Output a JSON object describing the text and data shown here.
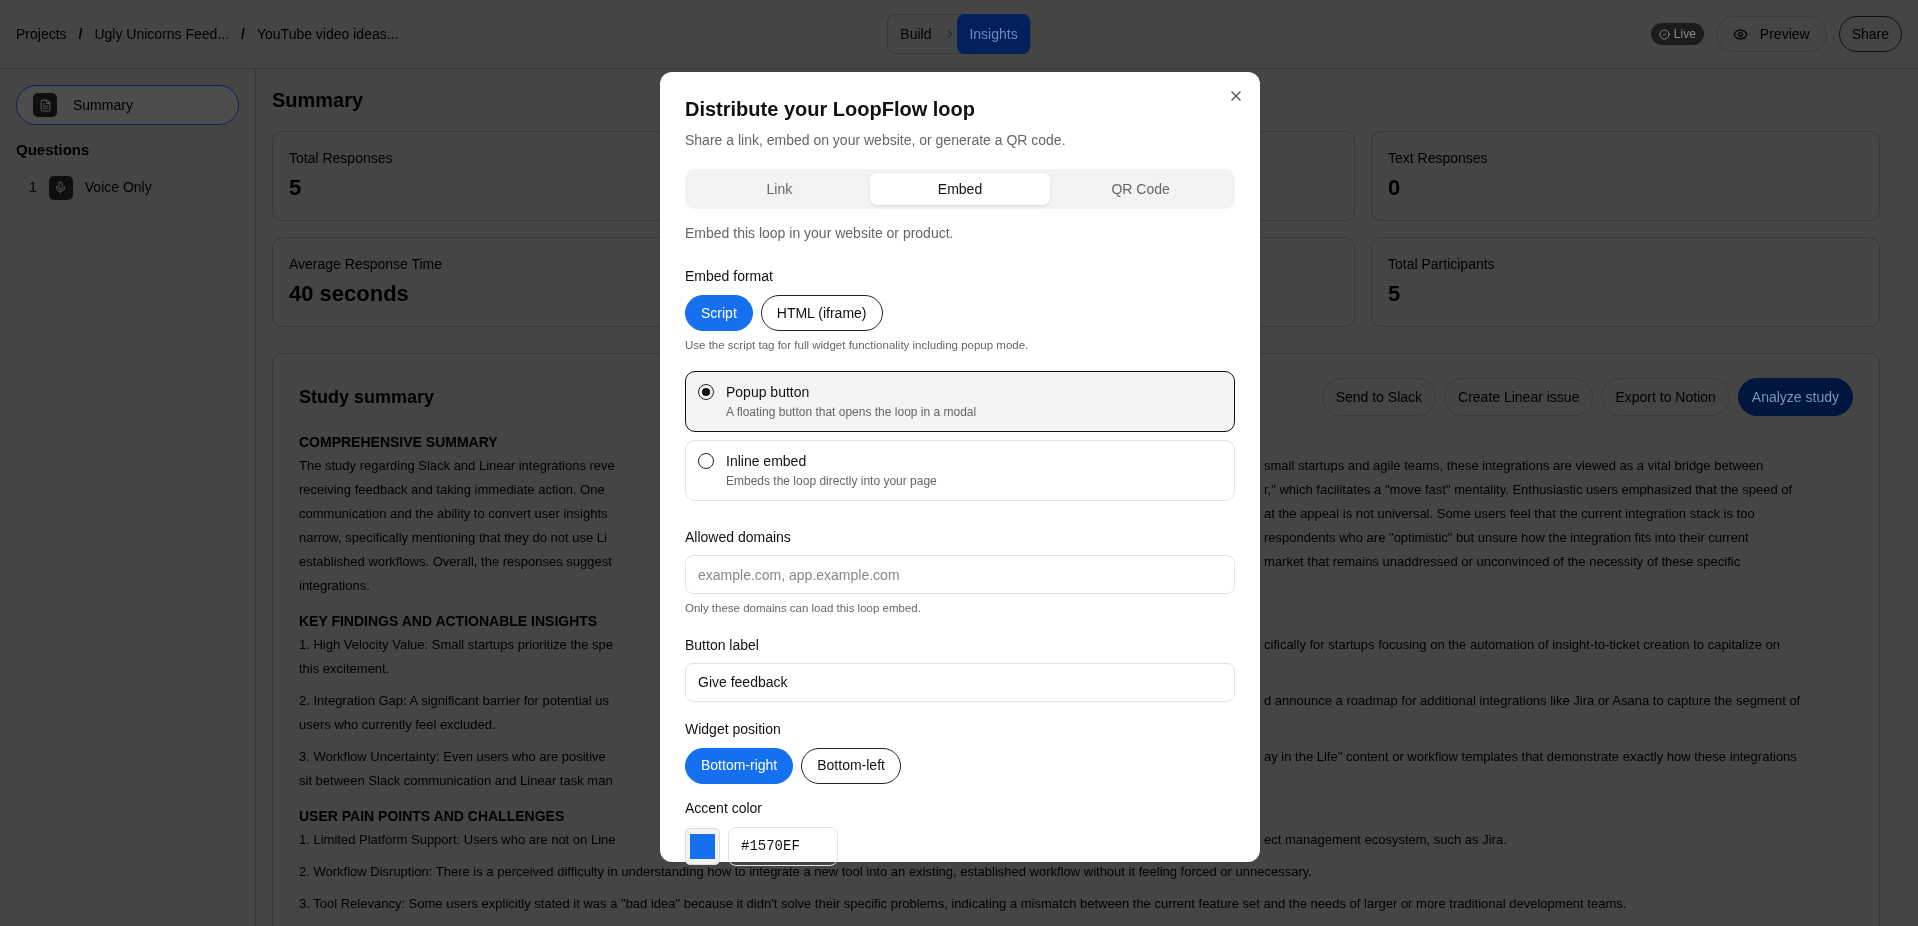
{
  "top_bar": {
    "breadcrumbs": [
      "Projects",
      "Ugly Unicorns Feed...",
      "YouTube video ideas..."
    ],
    "separator": "/",
    "mode_tabs": [
      {
        "label": "Build",
        "selected": false
      },
      {
        "label": "Insights",
        "selected": true
      }
    ],
    "live_badge": "Live",
    "preview_button": "Preview",
    "share_button": "Share"
  },
  "sidebar": {
    "summary_item": {
      "label": "Summary",
      "selected": true
    },
    "questions_heading": "Questions",
    "questions": [
      {
        "number": "1",
        "label": "Voice Only"
      }
    ]
  },
  "main": {
    "title": "Summary",
    "metric_rows": [
      {
        "left": {
          "label": "Total Responses",
          "value": "5"
        },
        "right": {
          "label": "Text Responses",
          "value": "0"
        }
      },
      {
        "left": {
          "label": "Average Response Time",
          "value": "40 seconds"
        },
        "right": {
          "label": "Total Participants",
          "value": "5"
        }
      }
    ],
    "study_summary": {
      "title": "Study summary",
      "actions": [
        {
          "label": "Send to Slack",
          "kind": "outline"
        },
        {
          "label": "Create Linear issue",
          "kind": "outline"
        },
        {
          "label": "Export to Notion",
          "kind": "outline"
        },
        {
          "label": "Analyze study",
          "kind": "primary"
        }
      ],
      "sections": [
        {
          "heading": "COMPREHENSIVE SUMMARY",
          "paragraphs": [
            [
              {
                "left": "The study regarding Slack and Linear integrations reve",
                "right": "small startups and agile teams, these integrations are viewed as a vital bridge between"
              },
              {
                "left": "receiving feedback and taking immediate action. One",
                "right": "r,\" which facilitates a \"move fast\" mentality. Enthusiastic users emphasized that the speed of"
              },
              {
                "left": "communication and the ability to convert user insights",
                "right": "at the appeal is not universal. Some users feel that the current integration stack is too"
              },
              {
                "left": "narrow, specifically mentioning that they do not use Li",
                "right": "respondents who are \"optimistic\" but unsure how the integration fits into their current"
              },
              {
                "left": "established workflows. Overall, the responses suggest",
                "right": "market that remains unaddressed or unconvinced of the necessity of these specific"
              },
              {
                "left": "integrations."
              }
            ]
          ]
        },
        {
          "heading": "KEY FINDINGS AND ACTIONABLE INSIGHTS",
          "paragraphs": [
            [
              {
                "left": "1. High Velocity Value: Small startups prioritize the spe",
                "right": "cifically for startups focusing on the automation of insight-to-ticket creation to capitalize on"
              },
              {
                "left": "this excitement."
              }
            ],
            [
              {
                "left": "2. Integration Gap: A significant barrier for potential us",
                "right": "d announce a roadmap for additional integrations like Jira or Asana to capture the segment of"
              },
              {
                "left": "users who currently feel excluded."
              }
            ],
            [
              {
                "left": "3. Workflow Uncertainty: Even users who are positive",
                "right": "ay in the Life\" content or workflow templates that demonstrate exactly how these integrations"
              },
              {
                "left": "sit between Slack communication and Linear task man"
              }
            ]
          ]
        },
        {
          "heading": "USER PAIN POINTS AND CHALLENGES",
          "paragraphs": [
            [
              {
                "left": "1. Limited Platform Support: Users who are not on Line",
                "right": "ect management ecosystem, such as Jira."
              }
            ],
            [
              {
                "left": "2. Workflow Disruption: There is a perceived difficulty in understanding how to integrate a new tool into an existing, established workflow without it feeling forced or unnecessary."
              }
            ],
            [
              {
                "left": "3. Tool Relevancy: Some users explicitly stated it was a \"bad idea\" because it didn't solve their specific problems, indicating a mismatch between the current feature set and the needs of larger or more traditional development teams."
              }
            ]
          ]
        }
      ]
    }
  },
  "modal": {
    "title": "Distribute your LoopFlow loop",
    "subtitle": "Share a link, embed on your website, or generate a QR code.",
    "tabs": [
      {
        "label": "Link",
        "selected": false
      },
      {
        "label": "Embed",
        "selected": true
      },
      {
        "label": "QR Code",
        "selected": false
      }
    ],
    "tab_description": "Embed this loop in your website or product.",
    "embed_format": {
      "label": "Embed format",
      "options": [
        {
          "label": "Script",
          "selected": true
        },
        {
          "label": "HTML (iframe)",
          "selected": false
        }
      ],
      "hint": "Use the script tag for full widget functionality including popup mode."
    },
    "embed_types": [
      {
        "title": "Popup button",
        "description": "A floating button that opens the loop in a modal",
        "selected": true
      },
      {
        "title": "Inline embed",
        "description": "Embeds the loop directly into your page",
        "selected": false
      }
    ],
    "allowed_domains": {
      "label": "Allowed domains",
      "placeholder": "example.com, app.example.com",
      "hint": "Only these domains can load this loop embed."
    },
    "button_label": {
      "label": "Button label",
      "value": "Give feedback"
    },
    "widget_position": {
      "label": "Widget position",
      "options": [
        {
          "label": "Bottom-right",
          "selected": true
        },
        {
          "label": "Bottom-left",
          "selected": false
        }
      ]
    },
    "accent_color": {
      "label": "Accent color",
      "value": "#1570EF"
    }
  }
}
